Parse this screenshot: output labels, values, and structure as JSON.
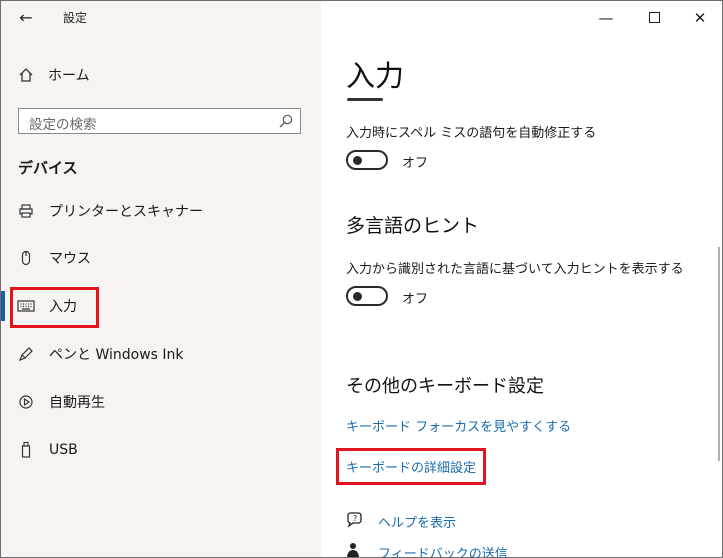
{
  "window": {
    "title": "設定",
    "controls": [
      "minimize",
      "maximize",
      "close"
    ]
  },
  "sidebar": {
    "home_label": "ホーム",
    "search_placeholder": "設定の検索",
    "section_heading": "デバイス",
    "selected": "入力",
    "items": [
      {
        "label": "プリンターとスキャナー",
        "icon": "printer-icon"
      },
      {
        "label": "マウス",
        "icon": "mouse-icon"
      },
      {
        "label": "入力",
        "icon": "keyboard-icon"
      },
      {
        "label": "ペンと Windows Ink",
        "icon": "pen-icon"
      },
      {
        "label": "自動再生",
        "icon": "autoplay-icon"
      },
      {
        "label": "USB",
        "icon": "usb-icon"
      }
    ]
  },
  "main": {
    "title": "入力",
    "autocorrect": {
      "description": "入力時にスペル ミスの語句を自動修正する",
      "state": "オフ"
    },
    "multilingual": {
      "heading": "多言語のヒント",
      "description": "入力から識別された言語に基づいて入力ヒントを表示する",
      "state": "オフ"
    },
    "other_keyboard": {
      "heading": "その他のキーボード設定",
      "links": [
        "キーボード フォーカスを見やすくする",
        "キーボードの詳細設定"
      ]
    },
    "help": {
      "show_help": "ヘルプを表示",
      "feedback": "フィードバックの送信"
    }
  },
  "annotations": {
    "highlight_color": "#e0141e"
  },
  "colors": {
    "sidebar_bg": "#f6f3f1",
    "link": "#1a6bb0",
    "accent": "#1b5f9e"
  }
}
